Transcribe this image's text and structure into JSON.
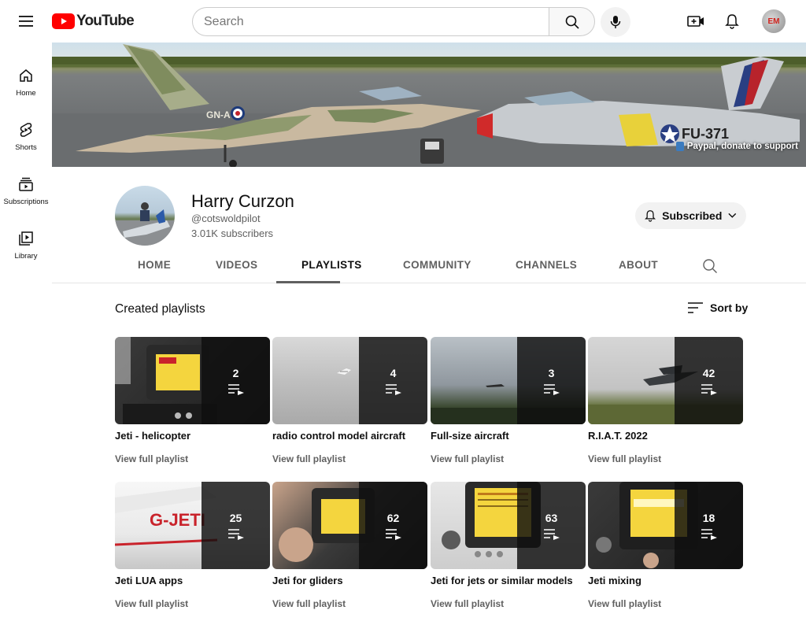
{
  "topbar": {
    "logo_text": "YouTube",
    "search_placeholder": "Search",
    "avatar_text": "EM"
  },
  "sidebar": {
    "items": [
      {
        "label": "Home",
        "icon": "home-icon"
      },
      {
        "label": "Shorts",
        "icon": "shorts-icon"
      },
      {
        "label": "Subscriptions",
        "icon": "subscriptions-icon"
      },
      {
        "label": "Library",
        "icon": "library-icon"
      }
    ]
  },
  "banner": {
    "donate_text": "Paypal, donate to support",
    "plane_left_marking": "GN-A",
    "plane_right_marking": "FU-371"
  },
  "channel": {
    "name": "Harry Curzon",
    "handle": "@cotswoldpilot",
    "subscribers": "3.01K subscribers",
    "subscribe_label": "Subscribed"
  },
  "tabs": [
    {
      "label": "HOME"
    },
    {
      "label": "VIDEOS"
    },
    {
      "label": "PLAYLISTS",
      "active": true
    },
    {
      "label": "COMMUNITY"
    },
    {
      "label": "CHANNELS"
    },
    {
      "label": "ABOUT"
    }
  ],
  "section": {
    "title": "Created playlists",
    "sort_label": "Sort by"
  },
  "playlists": [
    {
      "title": "Jeti - helicopter",
      "count": "2",
      "link": "View full playlist"
    },
    {
      "title": "radio control model aircraft",
      "count": "4",
      "link": "View full playlist"
    },
    {
      "title": "Full-size aircraft",
      "count": "3",
      "link": "View full playlist"
    },
    {
      "title": "R.I.A.T. 2022",
      "count": "42",
      "link": "View full playlist"
    },
    {
      "title": "Jeti LUA apps",
      "count": "25",
      "link": "View full playlist",
      "thumb_text": "G-JETI"
    },
    {
      "title": "Jeti for gliders",
      "count": "62",
      "link": "View full playlist"
    },
    {
      "title": "Jeti for jets or similar models",
      "count": "63",
      "link": "View full playlist"
    },
    {
      "title": "Jeti mixing",
      "count": "18",
      "link": "View full playlist"
    }
  ],
  "colors": {
    "brand_red": "#ff0000",
    "text_primary": "#0f0f0f",
    "text_secondary": "#606060"
  }
}
